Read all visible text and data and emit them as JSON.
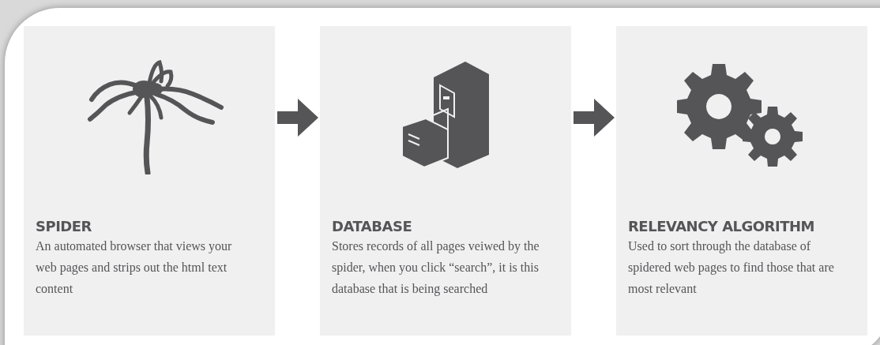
{
  "steps": [
    {
      "kind": "spider",
      "title": "SPIDER",
      "description": "An automated browser that views your web pages and strips out the html text content"
    },
    {
      "kind": "cabinet",
      "title": "DATABASE",
      "description": "Stores records of all pages veiwed by the spider, when you click “search”, it is this database that is being searched"
    },
    {
      "kind": "gears",
      "title": "RELEVANCY ALGORITHM",
      "description": "Used to sort through the database of spidered web pages to find those that are most relevant"
    }
  ]
}
